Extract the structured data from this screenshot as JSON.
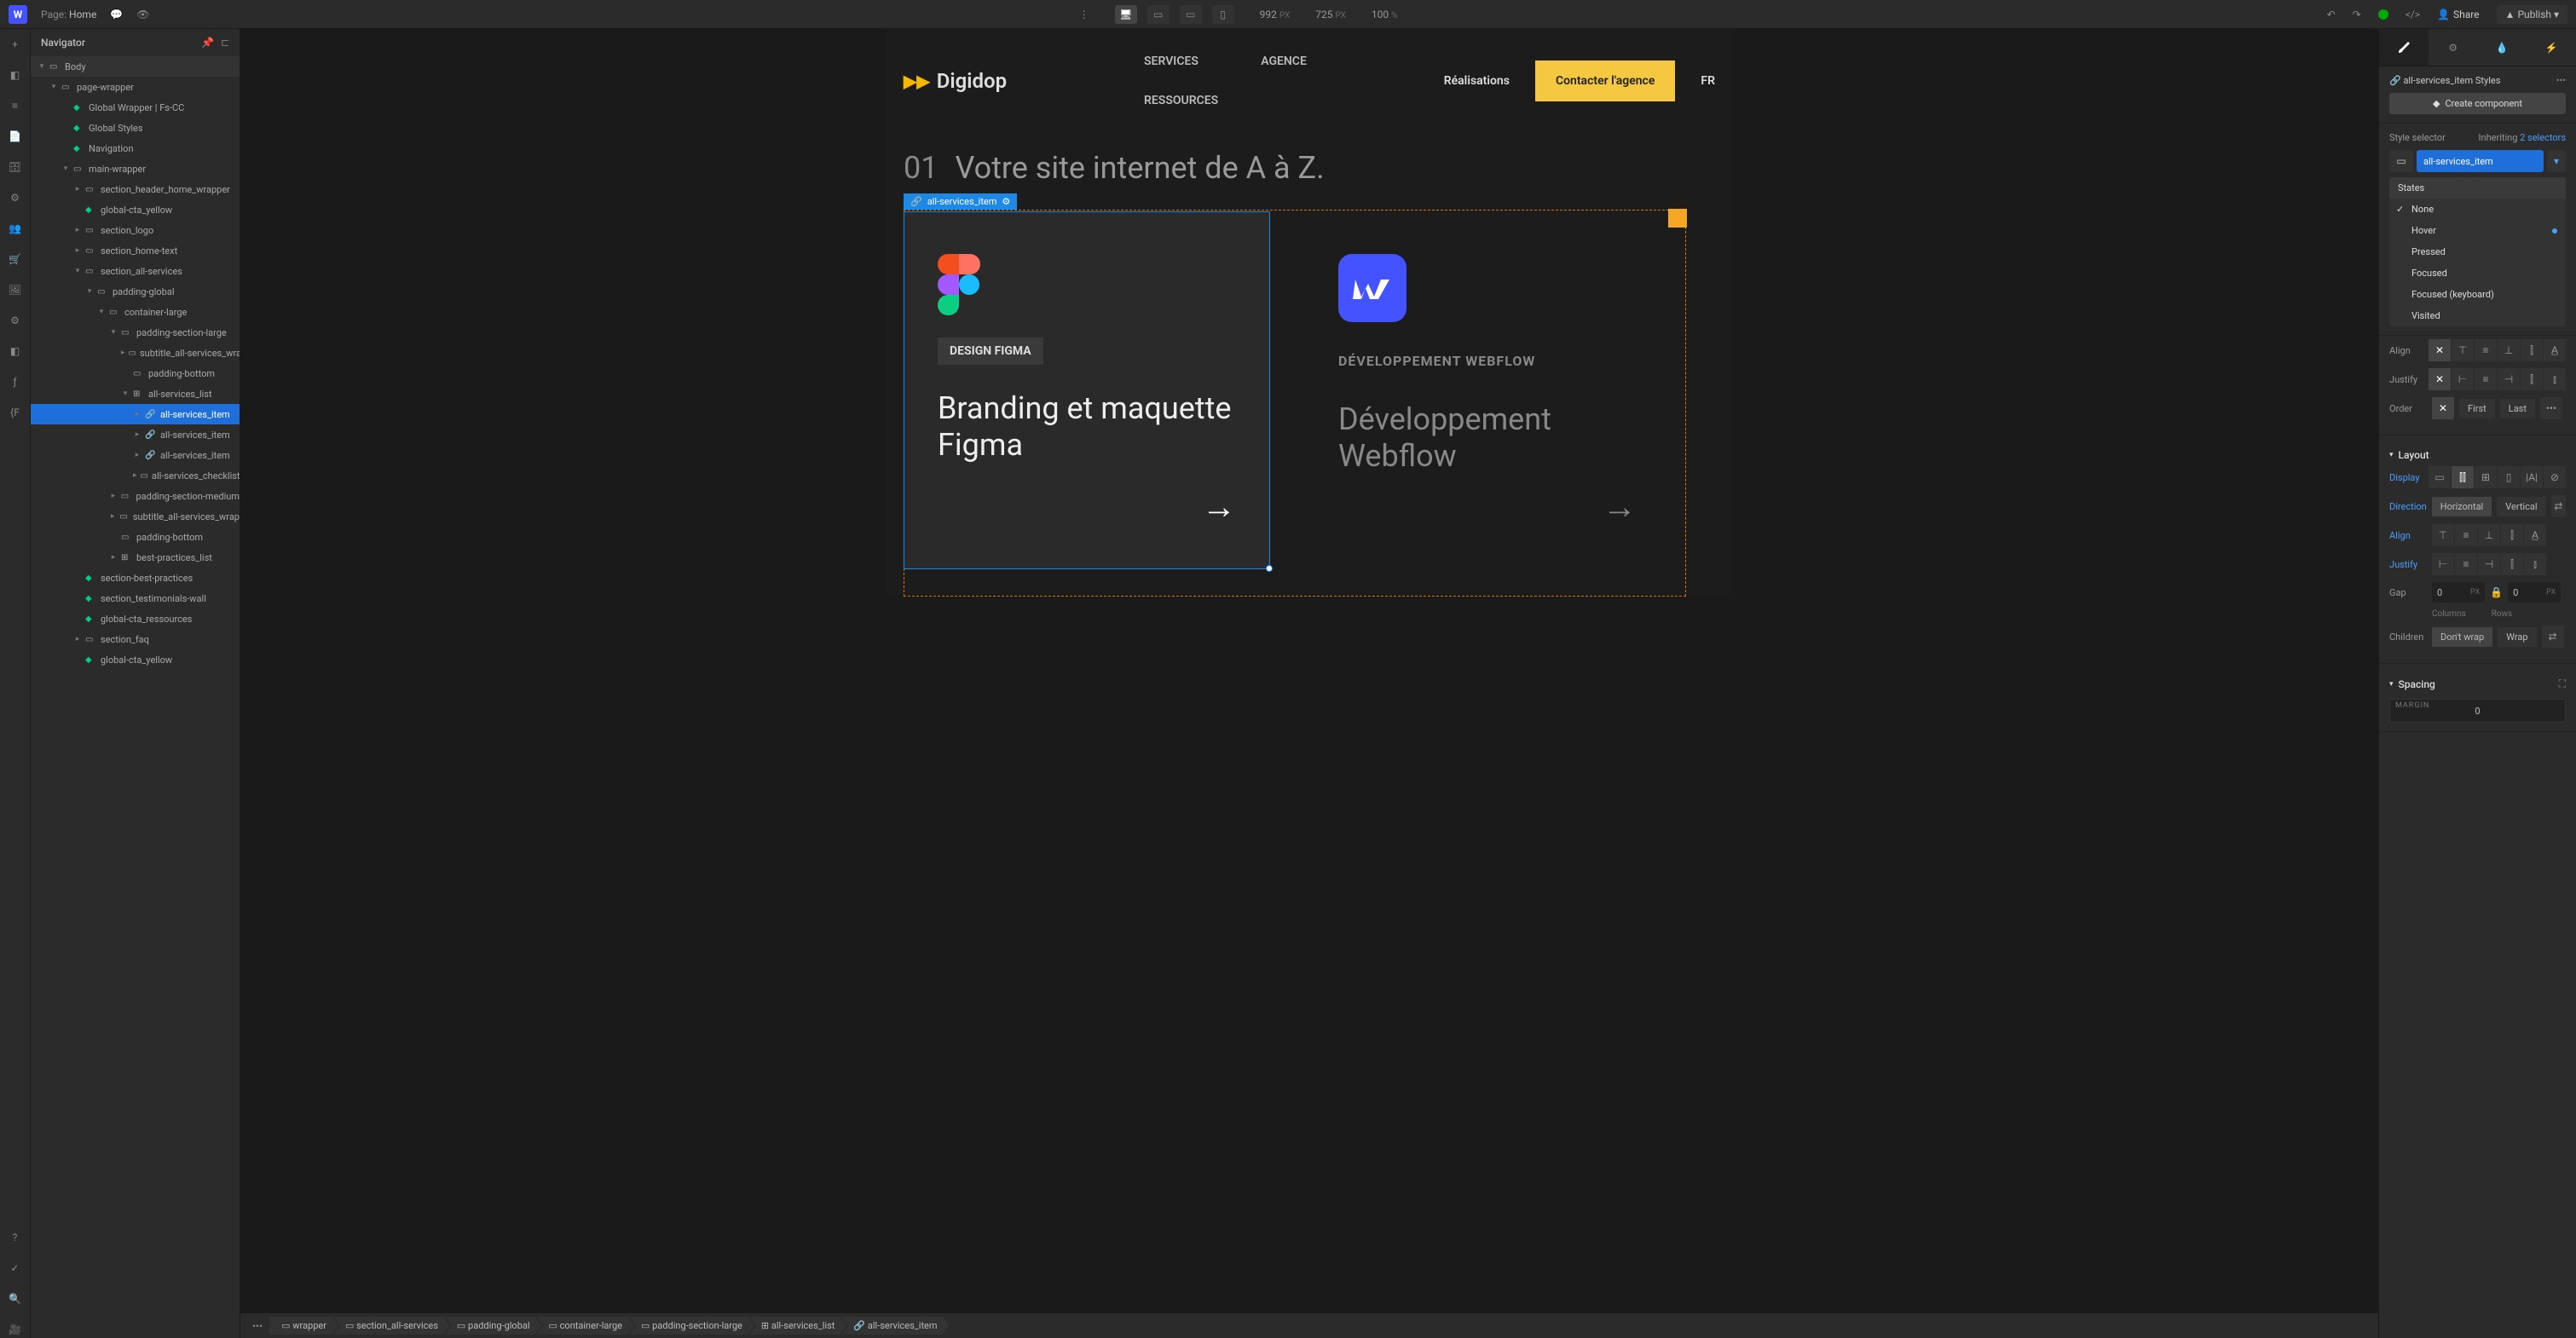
{
  "topbar": {
    "page_label": "Page:",
    "page_name": "Home",
    "dimensions": {
      "width": "992",
      "width_unit": "PX",
      "height": "725",
      "height_unit": "PX",
      "zoom": "100",
      "zoom_unit": "%"
    },
    "share": "Share",
    "publish": "Publish"
  },
  "navigator": {
    "title": "Navigator",
    "tree": [
      {
        "label": "Body",
        "depth": 0,
        "icon": "body",
        "open": true,
        "body": true
      },
      {
        "label": "page-wrapper",
        "depth": 1,
        "icon": "div",
        "open": true
      },
      {
        "label": "Global Wrapper | Fs-CC",
        "depth": 2,
        "icon": "comp"
      },
      {
        "label": "Global Styles",
        "depth": 2,
        "icon": "comp"
      },
      {
        "label": "Navigation",
        "depth": 2,
        "icon": "comp"
      },
      {
        "label": "main-wrapper",
        "depth": 2,
        "icon": "div",
        "open": true
      },
      {
        "label": "section_header_home_wrapper",
        "depth": 3,
        "icon": "div",
        "closed": true
      },
      {
        "label": "global-cta_yellow",
        "depth": 3,
        "icon": "comp"
      },
      {
        "label": "section_logo",
        "depth": 3,
        "icon": "div",
        "closed": true
      },
      {
        "label": "section_home-text",
        "depth": 3,
        "icon": "div",
        "closed": true
      },
      {
        "label": "section_all-services",
        "depth": 3,
        "icon": "div",
        "open": true
      },
      {
        "label": "padding-global",
        "depth": 4,
        "icon": "div",
        "open": true
      },
      {
        "label": "container-large",
        "depth": 5,
        "icon": "div",
        "open": true
      },
      {
        "label": "padding-section-large",
        "depth": 6,
        "icon": "div",
        "open": true
      },
      {
        "label": "subtitle_all-services_wrap",
        "depth": 7,
        "icon": "div",
        "closed": true
      },
      {
        "label": "padding-bottom",
        "depth": 7,
        "icon": "div"
      },
      {
        "label": "all-services_list",
        "depth": 7,
        "icon": "grid",
        "open": true
      },
      {
        "label": "all-services_item",
        "depth": 8,
        "icon": "link",
        "selected": true,
        "closed": true
      },
      {
        "label": "all-services_item",
        "depth": 8,
        "icon": "link",
        "closed": true
      },
      {
        "label": "all-services_item",
        "depth": 8,
        "icon": "link",
        "closed": true
      },
      {
        "label": "all-services_checklist_w",
        "depth": 8,
        "icon": "div",
        "closed": true
      },
      {
        "label": "padding-section-medium",
        "depth": 6,
        "icon": "div",
        "closed": true
      },
      {
        "label": "subtitle_all-services_wrap",
        "depth": 6,
        "icon": "div",
        "closed": true
      },
      {
        "label": "padding-bottom",
        "depth": 6,
        "icon": "div"
      },
      {
        "label": "best-practices_list",
        "depth": 6,
        "icon": "grid",
        "closed": true
      },
      {
        "label": "section-best-practices",
        "depth": 3,
        "icon": "comp"
      },
      {
        "label": "section_testimonials-wall",
        "depth": 3,
        "icon": "comp"
      },
      {
        "label": "global-cta_ressources",
        "depth": 3,
        "icon": "comp"
      },
      {
        "label": "section_faq",
        "depth": 3,
        "icon": "div",
        "closed": true
      },
      {
        "label": "global-cta_yellow",
        "depth": 3,
        "icon": "comp"
      }
    ]
  },
  "canvas": {
    "selected_tag": "all-services_item",
    "site": {
      "logo": "Digidop",
      "nav1": "SERVICES",
      "nav2": "AGENCE",
      "nav3": "RESSOURCES",
      "realisations": "Réalisations",
      "cta": "Contacter l'agence",
      "lang": "FR",
      "section_num": "01",
      "section_title": "Votre site internet de A à Z.",
      "card1_tag": "DESIGN FIGMA",
      "card1_title": "Branding et maquette Figma",
      "card2_tag": "DÉVELOPPEMENT WEBFLOW",
      "card2_title": "Développement Webflow"
    }
  },
  "breadcrumb": [
    "wrapper",
    "section_all-services",
    "padding-global",
    "container-large",
    "padding-section-large",
    "all-services_list",
    "all-services_item"
  ],
  "rightpanel": {
    "styles_title": "all-services_item Styles",
    "create_component": "Create component",
    "style_selector_label": "Style selector",
    "inheriting_label": "Inheriting",
    "inheriting_count": "2 selectors",
    "selector_chip": "all-services_item",
    "states_label": "States",
    "states": [
      {
        "label": "None",
        "checked": true
      },
      {
        "label": "Hover",
        "dot": true
      },
      {
        "label": "Pressed"
      },
      {
        "label": "Focused"
      },
      {
        "label": "Focused (keyboard)"
      },
      {
        "label": "Visited"
      }
    ],
    "align_label": "Align",
    "justify_label": "Justify",
    "order_label": "Order",
    "order_first": "First",
    "order_last": "Last",
    "layout_header": "Layout",
    "display_label": "Display",
    "direction_label": "Direction",
    "direction_horizontal": "Horizontal",
    "direction_vertical": "Vertical",
    "align2_label": "Align",
    "justify2_label": "Justify",
    "gap_label": "Gap",
    "gap_columns": "Columns",
    "gap_rows": "Rows",
    "gap_val1": "0",
    "gap_val2": "0",
    "gap_unit": "PX",
    "children_label": "Children",
    "dont_wrap": "Don't wrap",
    "wrap": "Wrap",
    "spacing_header": "Spacing",
    "margin_label": "MARGIN",
    "margin_top": "0"
  }
}
